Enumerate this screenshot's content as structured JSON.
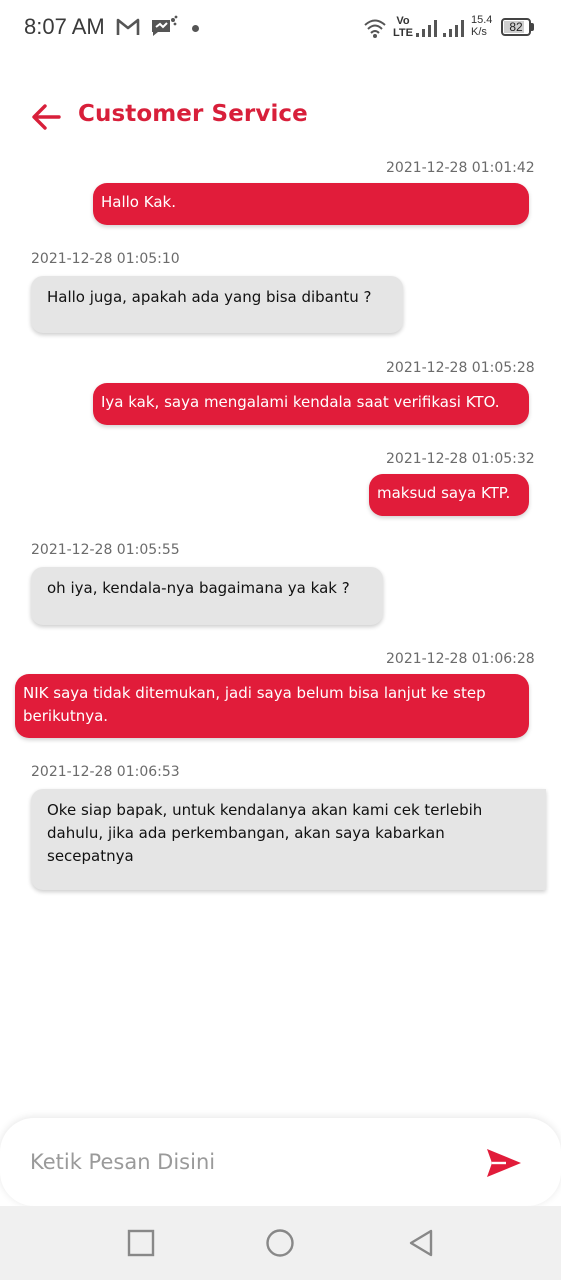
{
  "status_bar": {
    "time": "8:07 AM",
    "icons": [
      "gmail-icon",
      "message-icon",
      "wifi-icon",
      "volte-icon",
      "signal-icon",
      "battery-icon"
    ],
    "volte_top": "Vo",
    "volte_bottom": "LTE",
    "net_speed_value": "15.4",
    "net_speed_unit": "K/s",
    "battery_level": "82"
  },
  "header": {
    "title": "Customer Service"
  },
  "messages": [
    {
      "direction": "outgoing",
      "timestamp": "2021-12-28 01:01:42",
      "text": "Hallo Kak."
    },
    {
      "direction": "incoming",
      "timestamp": "2021-12-28 01:05:10",
      "text": "Hallo juga, apakah ada yang bisa dibantu ?"
    },
    {
      "direction": "outgoing",
      "timestamp": "2021-12-28 01:05:28",
      "text": "Iya kak, saya mengalami kendala saat verifikasi KTO."
    },
    {
      "direction": "outgoing",
      "timestamp": "2021-12-28 01:05:32",
      "text": "maksud saya KTP."
    },
    {
      "direction": "incoming",
      "timestamp": "2021-12-28 01:05:55",
      "text": "oh iya, kendala-nya bagaimana ya kak ?"
    },
    {
      "direction": "outgoing",
      "timestamp": "2021-12-28 01:06:28",
      "text": "NIK saya tidak ditemukan, jadi saya belum bisa lanjut ke step berikutnya."
    },
    {
      "direction": "incoming",
      "timestamp": "2021-12-28 01:06:53",
      "text": "Oke siap bapak, untuk kendalanya akan kami cek terlebih dahulu, jika ada perkembangan, akan saya kabarkan secepatnya"
    }
  ],
  "input": {
    "placeholder": "Ketik Pesan Disini",
    "value": ""
  },
  "colors": {
    "accent": "#e11c3a",
    "incoming_bubble": "#e5e5e5",
    "nav_bar": "#f0f0f0"
  }
}
